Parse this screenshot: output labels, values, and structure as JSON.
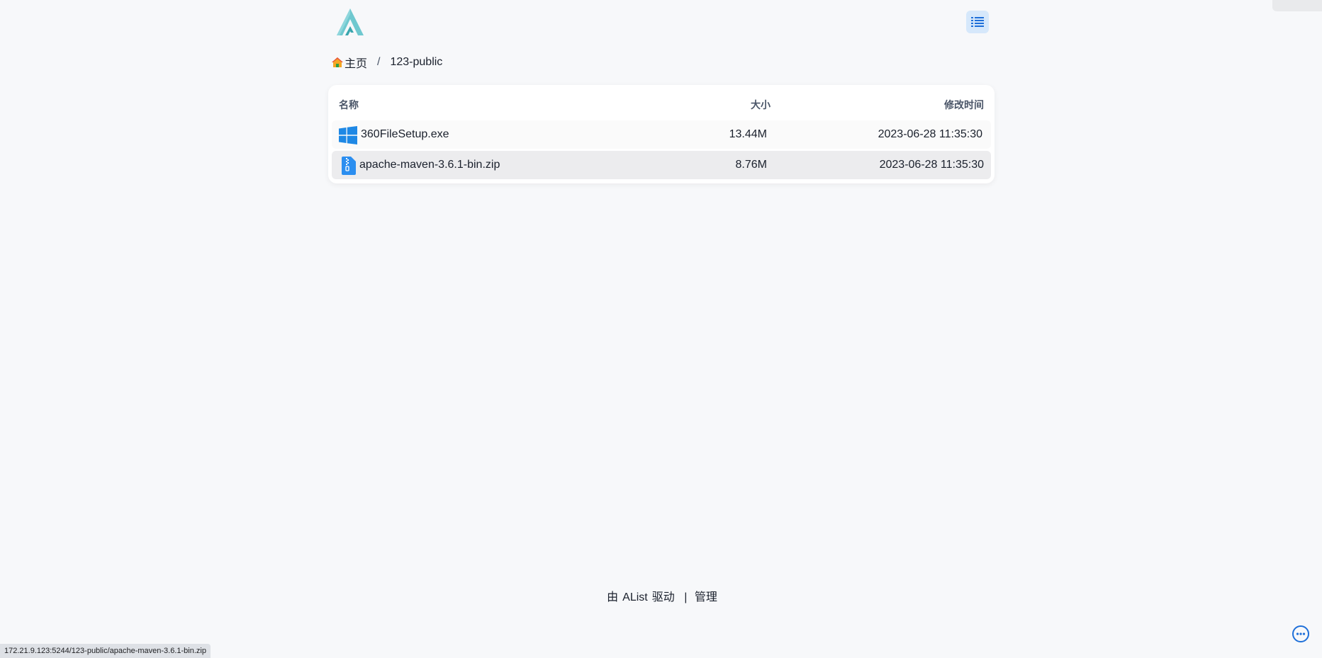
{
  "header": {
    "logo_icon": "alist-logo-icon",
    "layout_toggle_icon": "list-icon",
    "accent_color": "#1890ff"
  },
  "breadcrumb": {
    "home_label": "主页",
    "separator": "/",
    "current": "123-public"
  },
  "file_list": {
    "columns": {
      "name": "名称",
      "size": "大小",
      "modified": "修改时间"
    },
    "rows": [
      {
        "icon": "windows-icon",
        "name": "360FileSetup.exe",
        "size": "13.44M",
        "modified": "2023-06-28 11:35:30"
      },
      {
        "icon": "zip-file-icon",
        "name": "apache-maven-3.6.1-bin.zip",
        "size": "8.76M",
        "modified": "2023-06-28 11:35:30"
      }
    ]
  },
  "footer": {
    "powered_by_prefix": "由",
    "powered_by_name": "AList",
    "powered_by_suffix": "驱动",
    "separator": "|",
    "manage_label": "管理"
  },
  "status_bar": {
    "url": "172.21.9.123:5244/123-public/apache-maven-3.6.1-bin.zip"
  },
  "floating": {
    "more_icon": "more-dots-icon"
  }
}
